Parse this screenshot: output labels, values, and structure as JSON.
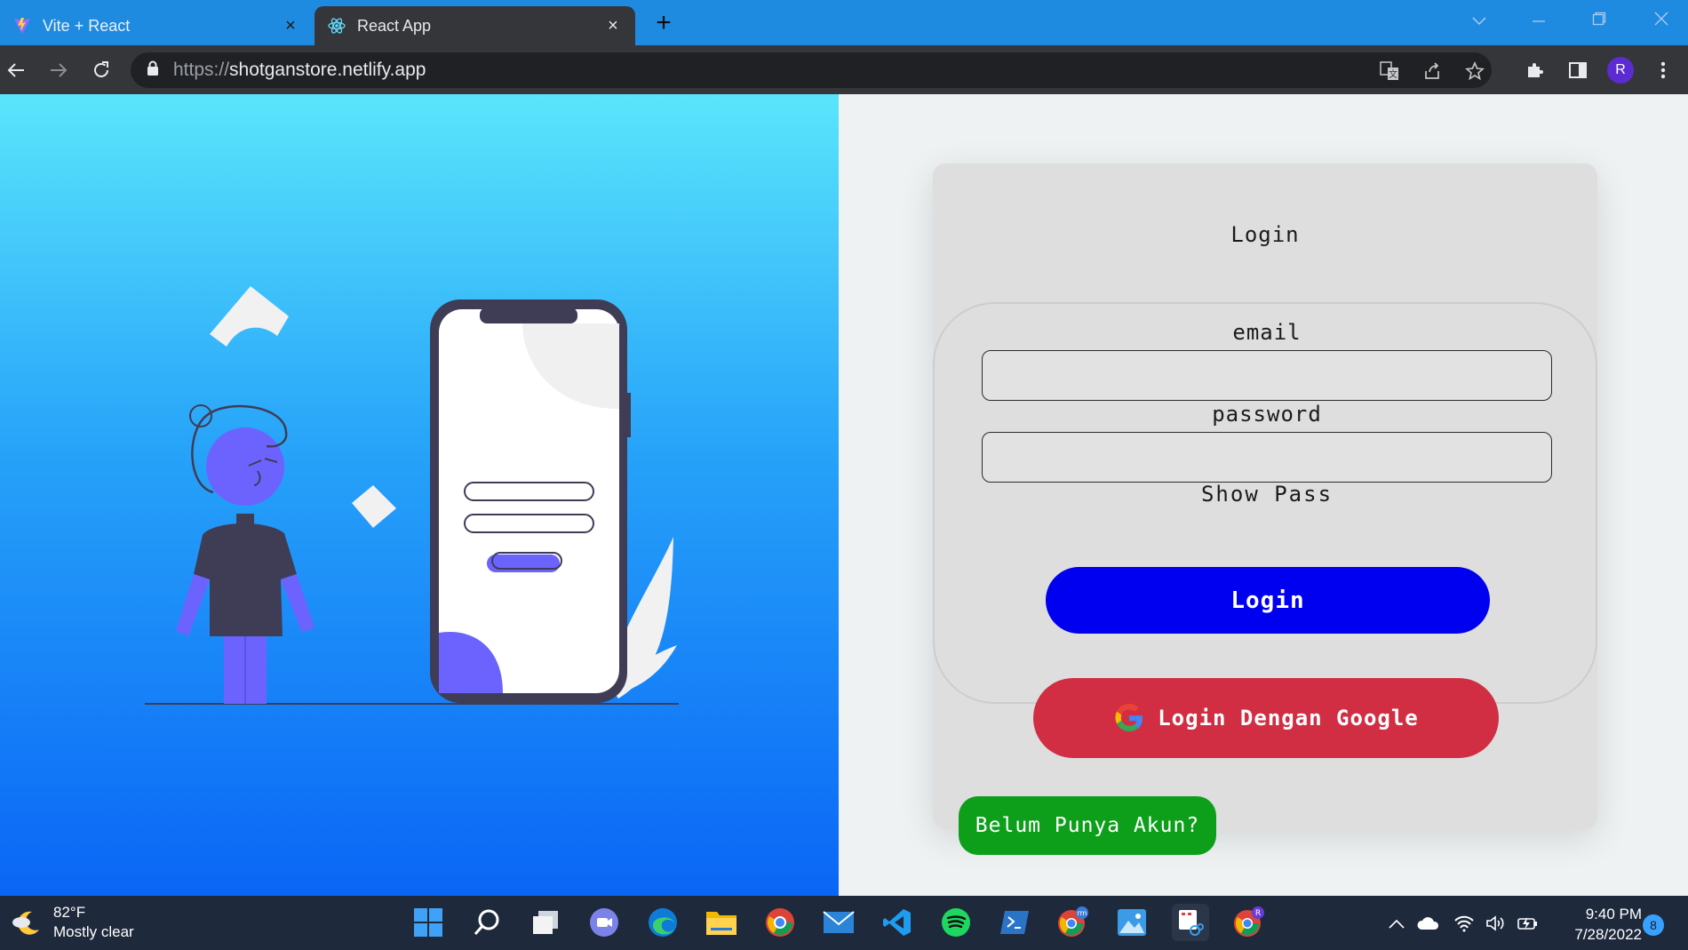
{
  "browser": {
    "tabs": [
      {
        "title": "Vite + React",
        "active": false,
        "favicon": "vite-icon"
      },
      {
        "title": "React App",
        "active": true,
        "favicon": "react-icon"
      }
    ],
    "new_tab_label": "+",
    "close_glyph": "×",
    "url_protocol": "https://",
    "url_host": "shotganstore.netlify.app",
    "profile_initial": "R",
    "window_controls": [
      "minimize",
      "restore",
      "close"
    ]
  },
  "login_card": {
    "title": "Login",
    "email_label": "email",
    "email_value": "",
    "password_label": "password",
    "password_value": "",
    "show_pass_label": "Show Pass",
    "login_button": "Login",
    "google_button": "Login Dengan Google",
    "signup_button": "Belum Punya Akun?"
  },
  "colors": {
    "login_button": "#0000f0",
    "google_button": "#d12e43",
    "signup_button": "#0d9f1a",
    "left_gradient_top": "#5ae5fb",
    "left_gradient_bottom": "#0a66f6"
  },
  "taskbar": {
    "weather_temp": "82°F",
    "weather_desc": "Mostly clear",
    "time": "9:40 PM",
    "date": "7/28/2022",
    "notification_count": "8",
    "apps": [
      "windows-start-icon",
      "search-icon",
      "task-view-icon",
      "teams-chat-icon",
      "edge-icon",
      "file-explorer-icon",
      "chrome-icon",
      "mail-icon",
      "vscode-icon",
      "spotify-icon",
      "terminal-icon",
      "chrome-profile-icon",
      "photos-icon",
      "snipping-tool-icon",
      "chrome-profile-r-icon"
    ]
  }
}
